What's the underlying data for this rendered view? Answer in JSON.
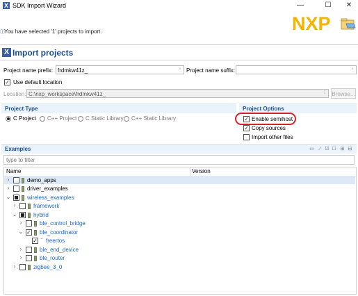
{
  "window": {
    "title": "SDK Import Wizard",
    "controls": {
      "minimize": "—",
      "maximize": "☐",
      "close": "✕"
    }
  },
  "header": {
    "message": "You have selected '1' projects to import.",
    "logo_text": "NXP"
  },
  "page": {
    "title": "Import projects"
  },
  "form": {
    "name_prefix_label": "Project name prefix:",
    "name_prefix_value": "frdmkw41z_",
    "name_suffix_label": "Project name suffix:",
    "name_suffix_value": "",
    "use_default_location_label": "Use default location",
    "use_default_location_checked": true,
    "location_label": "Location:",
    "location_value": "C:\\nxp_workspace\\frdmkw41z_",
    "browse_label": "Browse..."
  },
  "project_type": {
    "heading": "Project Type",
    "options": [
      {
        "label": "C Project",
        "selected": true
      },
      {
        "label": "C++ Project",
        "selected": false
      },
      {
        "label": "C Static Library",
        "selected": false
      },
      {
        "label": "C++ Static Library",
        "selected": false
      }
    ]
  },
  "project_options": {
    "heading": "Project Options",
    "enable_semihost": {
      "label": "Enable semihost",
      "checked": true
    },
    "copy_sources": {
      "label": "Copy sources",
      "checked": true
    },
    "import_other_files": {
      "label": "Import other files",
      "checked": false
    }
  },
  "examples": {
    "heading": "Examples",
    "filter_placeholder": "type to filter",
    "columns": {
      "name": "Name",
      "version": "Version"
    },
    "tree": [
      {
        "label": "demo_apps",
        "twisty": "›",
        "check": "none",
        "highlight": true
      },
      {
        "label": "driver_examples",
        "twisty": "›",
        "check": "none",
        "highlight": false
      },
      {
        "label": "wireless_examples",
        "twisty": "⌄",
        "check": "partial",
        "highlight": false
      },
      {
        "label": "framework",
        "twisty": "›",
        "check": "none",
        "highlight": false
      },
      {
        "label": "hybrid",
        "twisty": "⌄",
        "check": "partial",
        "highlight": false
      },
      {
        "label": "ble_control_bridge",
        "twisty": "›",
        "check": "none",
        "highlight": false
      },
      {
        "label": "ble_coordinator",
        "twisty": "⌄",
        "check": "checked",
        "highlight": false
      },
      {
        "label": "freertos",
        "twisty": "",
        "check": "checked",
        "highlight": false
      },
      {
        "label": "ble_end_device",
        "twisty": "›",
        "check": "none",
        "highlight": false
      },
      {
        "label": "ble_router",
        "twisty": "›",
        "check": "none",
        "highlight": false
      },
      {
        "label": "zigbee_3_0",
        "twisty": "›",
        "check": "none",
        "highlight": false
      }
    ]
  }
}
